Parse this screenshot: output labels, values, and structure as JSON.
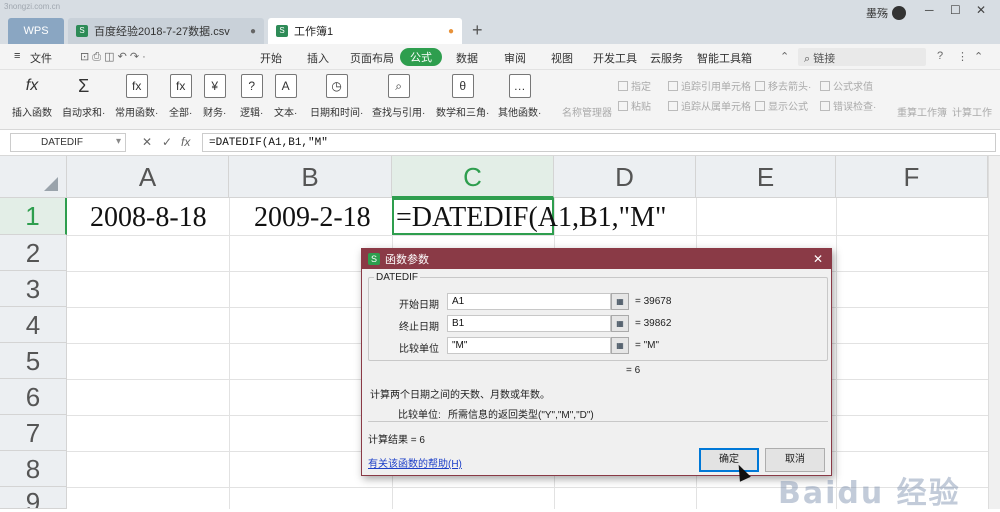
{
  "watermark_top": "3nongzi.com.cn",
  "tabs": [
    {
      "label": "WPS"
    },
    {
      "label": "百度经验2018-7-27数据.csv",
      "close": "●"
    },
    {
      "label": "工作簿1",
      "close": "●"
    }
  ],
  "new_tab": "+",
  "user": {
    "name": "墨殇"
  },
  "window_controls": [
    "─",
    "☐",
    "✕"
  ],
  "menubar": {
    "file_label": "文件",
    "tabs": [
      "开始",
      "插入",
      "页面布局",
      "公式",
      "数据",
      "审阅",
      "视图",
      "开发工具",
      "云服务",
      "智能工具箱"
    ],
    "active_tab": "公式",
    "search_placeholder": "链接"
  },
  "ribbon": {
    "buttons": [
      {
        "label": "插入函数",
        "icon": "fx"
      },
      {
        "label": "自动求和·",
        "icon": "Σ"
      },
      {
        "label": "常用函数·",
        "icon": "fx"
      },
      {
        "label": "全部·",
        "icon": "fx"
      },
      {
        "label": "财务·",
        "icon": "¥"
      },
      {
        "label": "逻辑·",
        "icon": "?"
      },
      {
        "label": "文本·",
        "icon": "A"
      },
      {
        "label": "日期和时间·",
        "icon": "◷"
      },
      {
        "label": "查找与引用·",
        "icon": "⌕"
      },
      {
        "label": "数学和三角·",
        "icon": "θ"
      },
      {
        "label": "其他函数·",
        "icon": "…"
      }
    ],
    "disabled": [
      "名称管理器",
      "指定",
      "粘贴",
      "追踪引用单元格",
      "追踪从属单元格",
      "移去箭头·",
      "显示公式",
      "公式求值",
      "错误检查·",
      "重算工作簿",
      "计算工作"
    ]
  },
  "formula_bar": {
    "name_box": "DATEDIF",
    "formula": "=DATEDIF(A1,B1,\"M\""
  },
  "sheet": {
    "columns": [
      "A",
      "B",
      "C",
      "D",
      "E",
      "F"
    ],
    "rows": [
      "1",
      "2",
      "3",
      "4",
      "5",
      "6",
      "7",
      "8",
      "9"
    ],
    "cells": {
      "A1": "2008-8-18",
      "B1": "2009-2-18",
      "C1": "=DATEDIF(A1,B1,\"M\""
    },
    "active_cell": "C1"
  },
  "dialog": {
    "title": "函数参数",
    "function_name": "DATEDIF",
    "params": [
      {
        "label": "开始日期",
        "value": "A1",
        "result": "=  39678"
      },
      {
        "label": "终止日期",
        "value": "B1",
        "result": "=  39862"
      },
      {
        "label": "比较单位",
        "value": "\"M\"",
        "result": "=  \"M\""
      }
    ],
    "preview_result": "=  6",
    "description": "计算两个日期之间的天数、月数或年数。",
    "param_help_label": "比较单位:",
    "param_help_text": "所需信息的返回类型(\"Y\",\"M\",\"D\")",
    "calc_result": "计算结果  =  6",
    "help_link": "有关该函数的帮助(H)",
    "ok": "确定",
    "cancel": "取消"
  },
  "watermark": "Baidu 经验"
}
